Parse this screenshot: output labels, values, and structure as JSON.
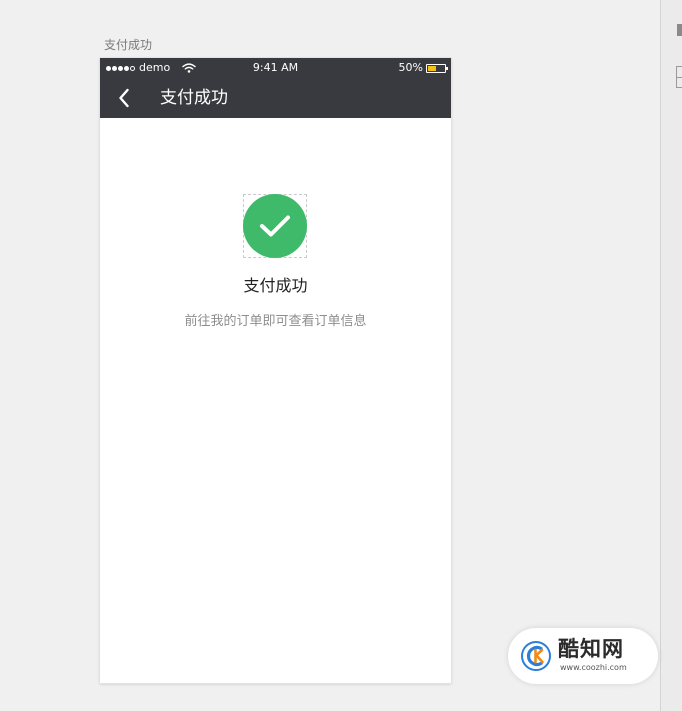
{
  "artboard": {
    "label": "支付成功"
  },
  "status_bar": {
    "carrier": "demo",
    "signal_filled": 4,
    "signal_total": 5,
    "time": "9:41 AM",
    "battery_percent": "50%",
    "battery_level": 0.5,
    "battery_color": "#f4c21a"
  },
  "nav": {
    "title": "支付成功",
    "back_icon": "chevron-left-icon",
    "background": "#393a3f"
  },
  "result": {
    "icon": "checkmark-circle-icon",
    "icon_color": "#3fba6b",
    "title": "支付成功",
    "description": "前往我的订单即可查看订单信息"
  },
  "watermark": {
    "brand": "酷知网",
    "url": "www.coozhi.com"
  }
}
